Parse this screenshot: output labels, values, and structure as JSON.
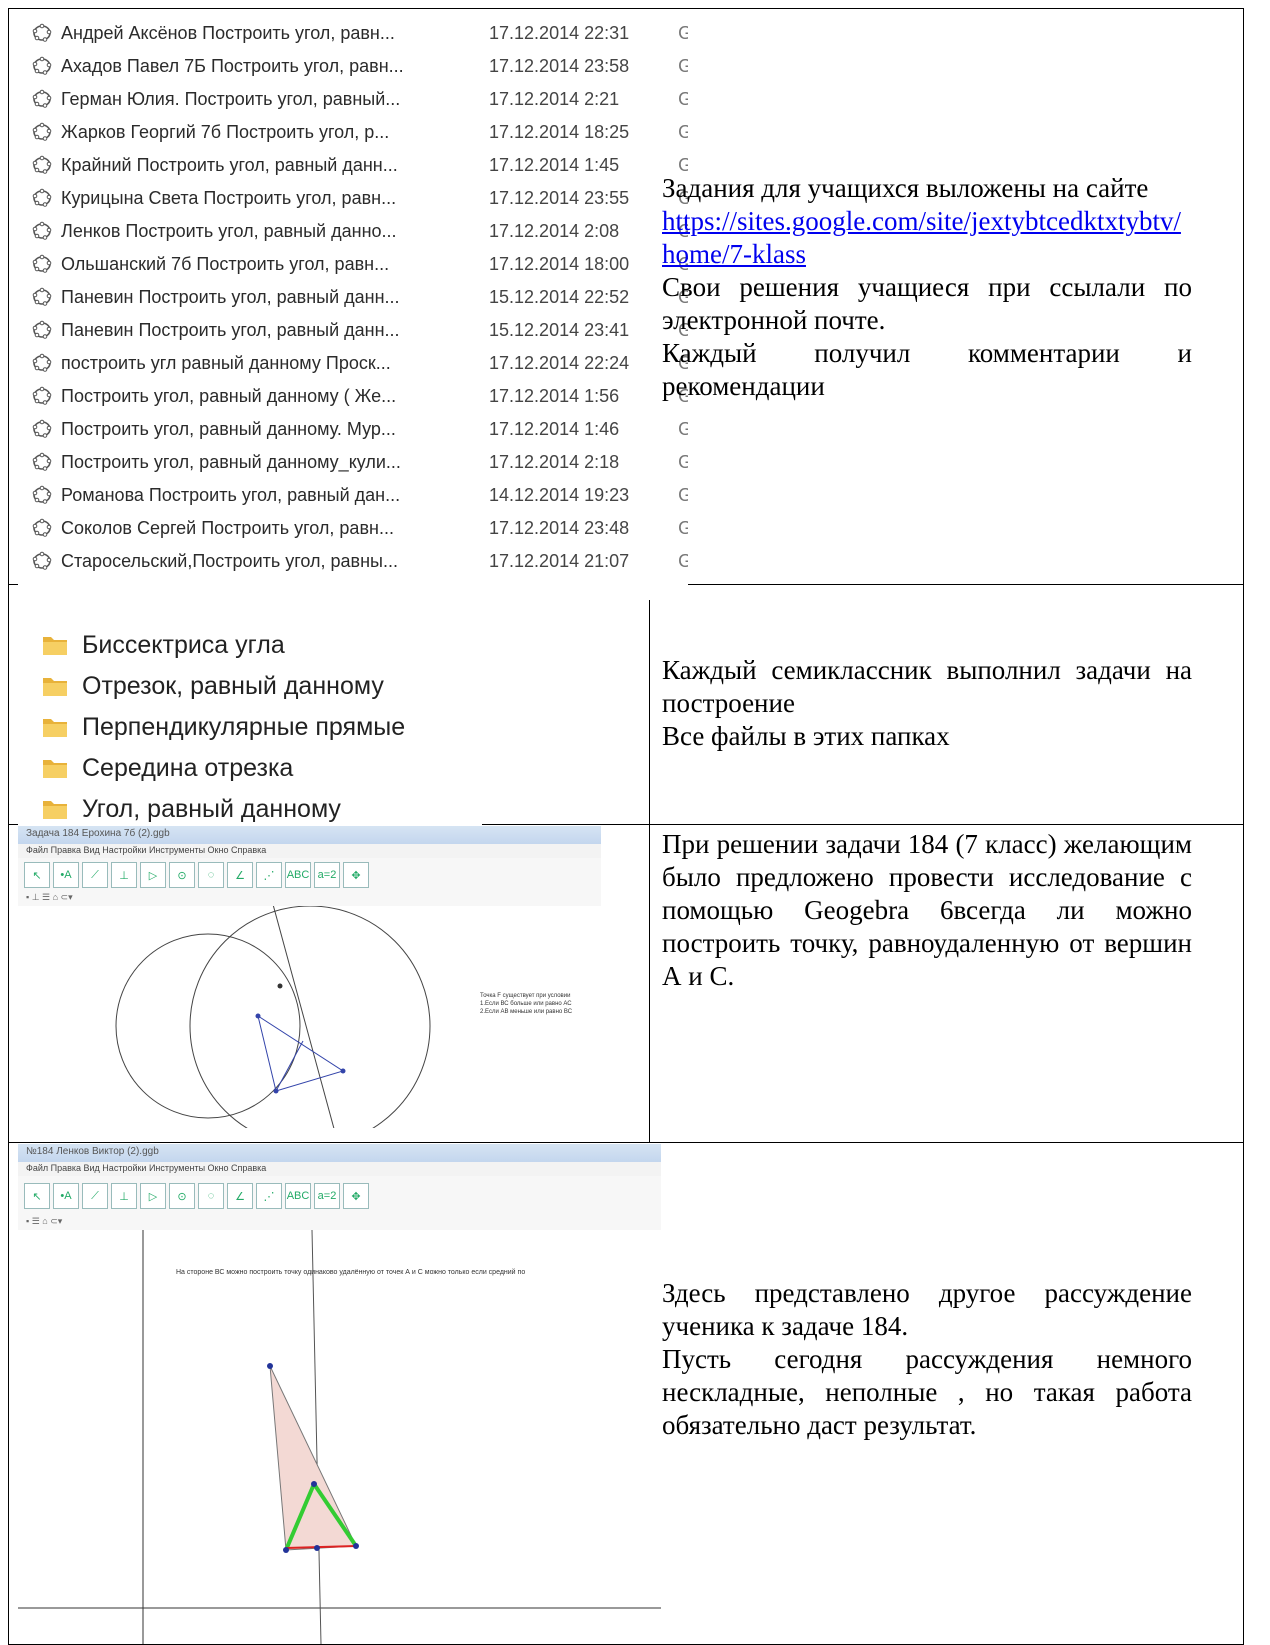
{
  "files": [
    {
      "name": "Андрей Аксёнов Построить угол, равн...",
      "date": "17.12.2014 22:31",
      "type": "Geo"
    },
    {
      "name": "Ахадов Павел 7Б Построить угол, равн...",
      "date": "17.12.2014 23:58",
      "type": "Geo"
    },
    {
      "name": "Герман Юлия. Построить угол, равный...",
      "date": "17.12.2014 2:21",
      "type": "Geo"
    },
    {
      "name": "Жарков Георгий 7б Построить угол, р...",
      "date": "17.12.2014 18:25",
      "type": "Geo"
    },
    {
      "name": "Крайний Построить угол, равный данн...",
      "date": "17.12.2014 1:45",
      "type": "Geo"
    },
    {
      "name": "Курицына Света Построить угол, равн...",
      "date": "17.12.2014 23:55",
      "type": "Geo"
    },
    {
      "name": "Ленков Построить угол, равный данно...",
      "date": "17.12.2014 2:08",
      "type": "Geo"
    },
    {
      "name": "Ольшанский 7б Построить угол, равн...",
      "date": "17.12.2014 18:00",
      "type": "Geo"
    },
    {
      "name": "Паневин Построить угол, равный данн...",
      "date": "15.12.2014 22:52",
      "type": "Geo"
    },
    {
      "name": "Паневин Построить угол, равный данн...",
      "date": "15.12.2014 23:41",
      "type": "Geo"
    },
    {
      "name": "построить угл равный данному Проск...",
      "date": "17.12.2014 22:24",
      "type": "Geo"
    },
    {
      "name": "Построить угол, равный данному ( Же...",
      "date": "17.12.2014 1:56",
      "type": "Geo"
    },
    {
      "name": "Построить угол, равный данному. Мур...",
      "date": "17.12.2014 1:46",
      "type": "Geo"
    },
    {
      "name": "Построить угол, равный данному_кули...",
      "date": "17.12.2014 2:18",
      "type": "Geo"
    },
    {
      "name": "Романова Построить угол, равный дан...",
      "date": "14.12.2014 19:23",
      "type": "Geo"
    },
    {
      "name": "Соколов Сергей Построить угол, равн...",
      "date": "17.12.2014 23:48",
      "type": "Geo"
    },
    {
      "name": "Старосельский,Построить угол, равны...",
      "date": "17.12.2014 21:07",
      "type": "Geo"
    }
  ],
  "row1": {
    "line1": "Задания для учащихся выложены на сайте",
    "link": "https://sites.google.com/site/jextybtcedktxtybtv/home/7-klass",
    "line2": "Свои решения учащиеся при ссылали по электронной почте.",
    "line3": "Каждый получил комментарии и рекомендации"
  },
  "folders": [
    "Биссектриса угла",
    "Отрезок, равный данному",
    "Перпендикулярные прямые",
    "Середина отрезка",
    "Угол, равный данному"
  ],
  "row2": {
    "line1": "Каждый семиклассник выполнил задачи на построение",
    "line2": "Все файлы в этих папках"
  },
  "row3": {
    "text": "При решении задачи 184 (7 класс) желающим было предложено провести исследование с помощью Geogebra 6всегда ли можно построить точку, равноудаленную от вершин А и С."
  },
  "row4": {
    "line1": "Здесь представлено другое рассуждение ученика к задаче 184.",
    "line2": "Пусть сегодня рассуждения немного нескладные, неполные , но такая работа обязательно даст результат."
  },
  "geo1": {
    "title": "Задача 184 Ерохина 7б (2).ggb",
    "menu": "Файл Правка Вид Настройки Инструменты Окно Справка",
    "note": [
      "Точка F существует при условии",
      "1.Если ВС больше или равно АС",
      "2.Если АВ меньше или равно ВС"
    ]
  },
  "geo2": {
    "title": "№184 Ленков Виктор (2).ggb",
    "menu": "Файл Правка Вид Настройки Инструменты Окно Справка",
    "note": "На стороне ВС можно построить точку одинаково удалённую от точек А и С можно только если средний по"
  },
  "colors": {
    "link": "#0000ee",
    "folder": "#e8b23a",
    "triangle_fill": "#f3d9d4",
    "green": "#33cc33",
    "red": "#dd2222"
  }
}
